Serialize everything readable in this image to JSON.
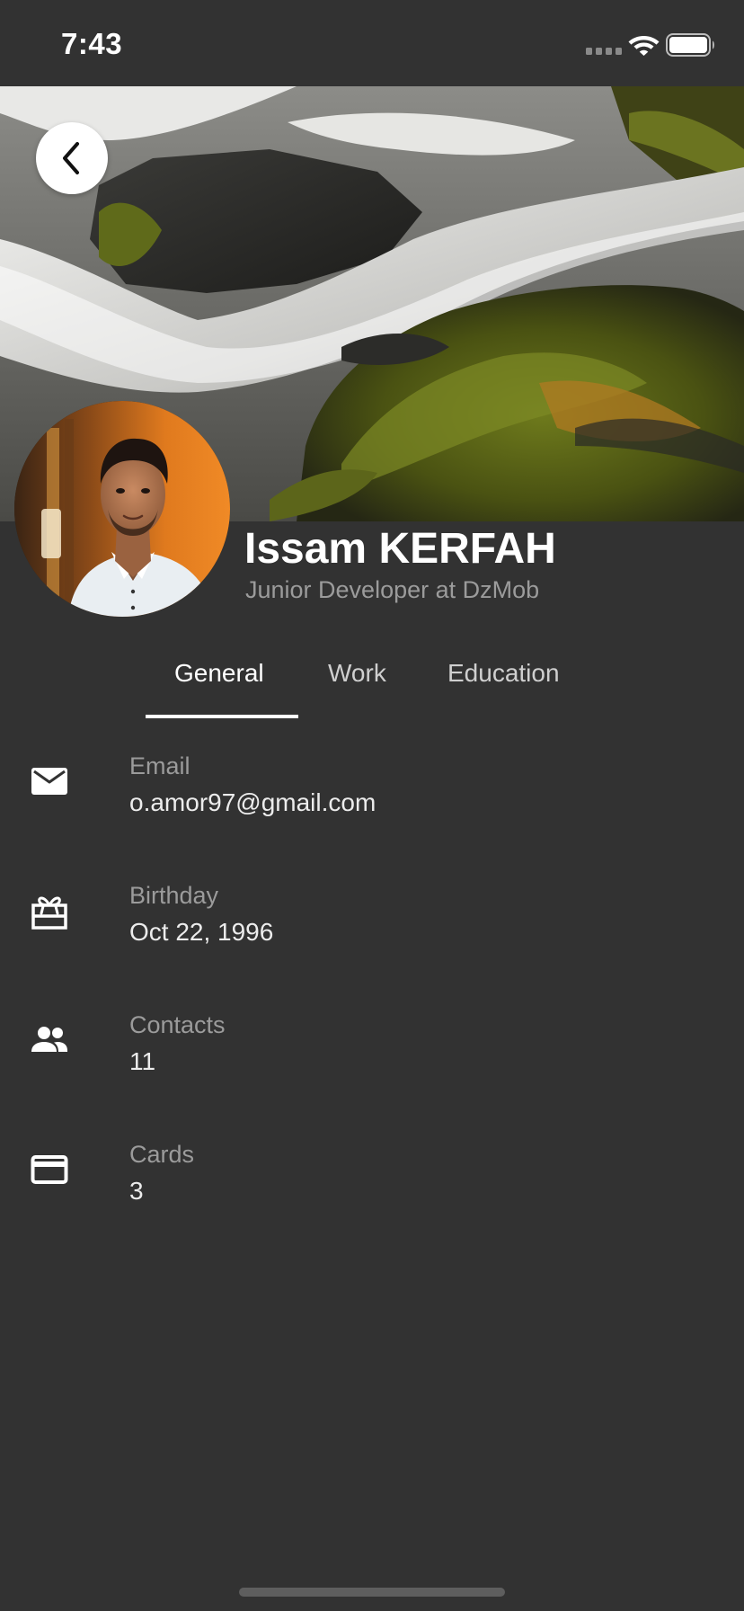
{
  "status_bar": {
    "time": "7:43"
  },
  "header": {
    "cover_image": "waterfall-cover-photo",
    "back_icon": "chevron-left-icon"
  },
  "profile": {
    "name": "Issam KERFAH",
    "subtitle": "Junior Developer at DzMob",
    "avatar": "profile-photo"
  },
  "tabs": [
    {
      "label": "General",
      "active": true
    },
    {
      "label": "Work",
      "active": false
    },
    {
      "label": "Education",
      "active": false
    }
  ],
  "info": [
    {
      "icon": "email-icon",
      "label": "Email",
      "value": "o.amor97@gmail.com"
    },
    {
      "icon": "cake-icon",
      "label": "Birthday",
      "value": "Oct 22, 1996"
    },
    {
      "icon": "people-icon",
      "label": "Contacts",
      "value": "11"
    },
    {
      "icon": "credit-card-icon",
      "label": "Cards",
      "value": "3"
    }
  ],
  "colors": {
    "background": "#323232",
    "text_primary": "#ffffff",
    "text_secondary": "#9b9b9b"
  }
}
